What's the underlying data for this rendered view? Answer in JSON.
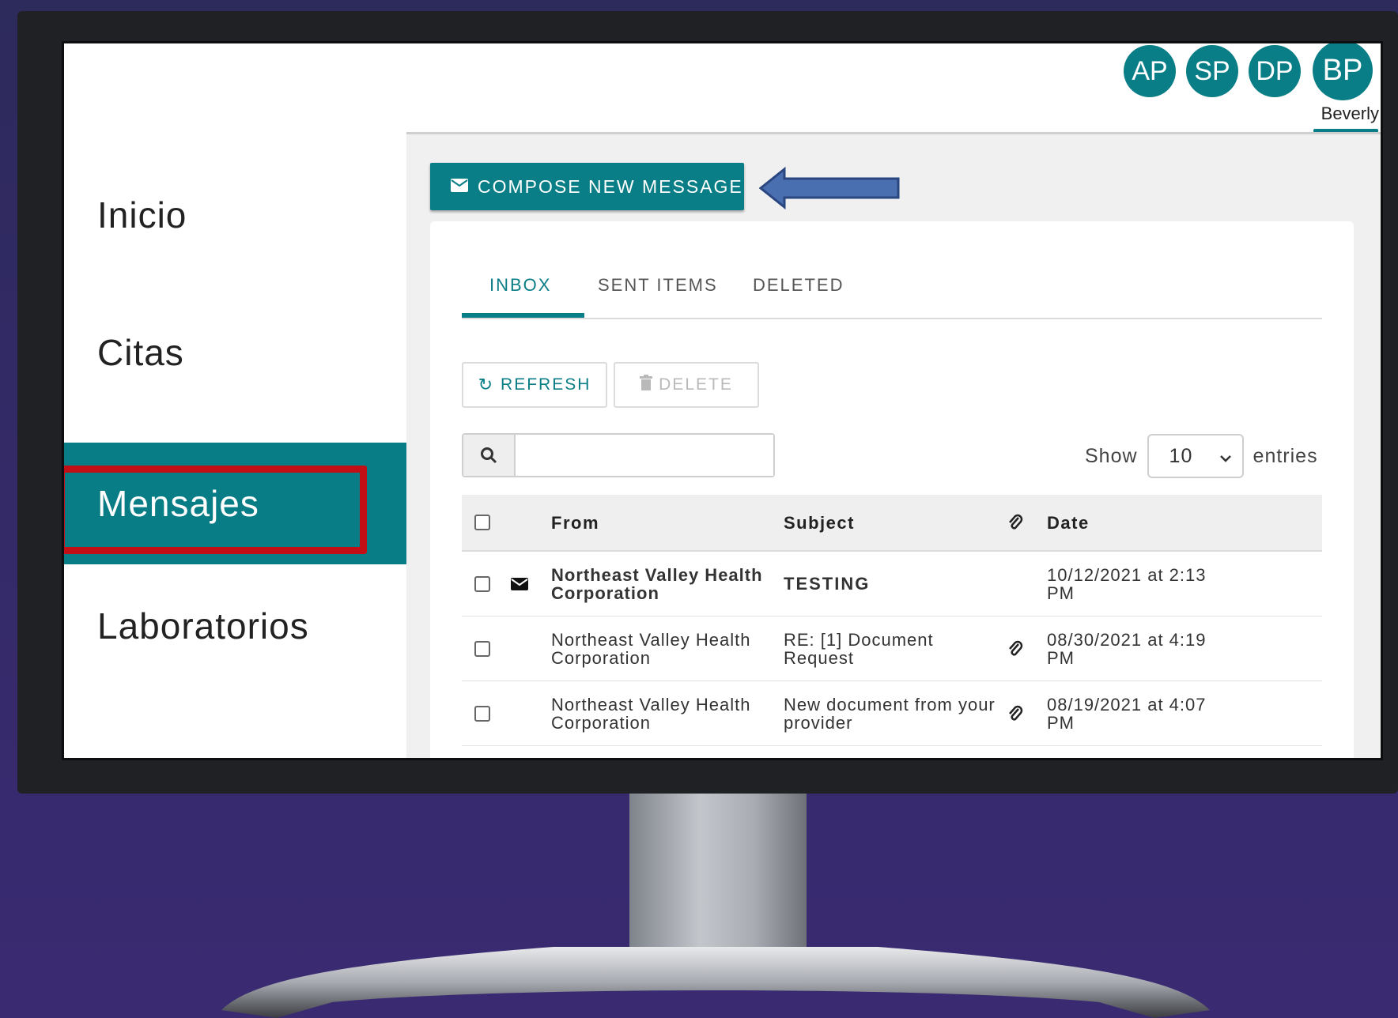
{
  "sidebar": {
    "items": [
      {
        "label": "Inicio"
      },
      {
        "label": "Citas"
      },
      {
        "label": "Mensajes"
      },
      {
        "label": "Laboratorios"
      }
    ]
  },
  "header": {
    "avatars": [
      "AP",
      "SP",
      "DP",
      "BP"
    ],
    "user_name": "Beverly"
  },
  "compose_label": "COMPOSE NEW MESSAGE",
  "tabs": [
    {
      "label": "INBOX"
    },
    {
      "label": "SENT ITEMS"
    },
    {
      "label": "DELETED"
    }
  ],
  "toolbar": {
    "refresh_label": "REFRESH",
    "delete_label": "DELETE"
  },
  "search": {
    "value": ""
  },
  "show": {
    "prefix": "Show",
    "value": "10",
    "suffix": "entries"
  },
  "table": {
    "headers": {
      "from": "From",
      "subject": "Subject",
      "date": "Date"
    },
    "rows": [
      {
        "from": "Northeast Valley Health Corporation",
        "subject": "TESTING",
        "date": "10/12/2021 at 2:13 PM",
        "unread": true,
        "attachment": false
      },
      {
        "from": "Northeast Valley Health Corporation",
        "subject": "RE: [1] Document Request",
        "date": "08/30/2021 at 4:19 PM",
        "unread": false,
        "attachment": true
      },
      {
        "from": "Northeast Valley Health Corporation",
        "subject": "New document from your provider",
        "date": "08/19/2021 at 4:07 PM",
        "unread": false,
        "attachment": true
      }
    ]
  },
  "colors": {
    "accent": "#0a7e86",
    "highlight": "#c20f15",
    "arrow": "#4a6fb0",
    "background": "#2d2a5c"
  }
}
